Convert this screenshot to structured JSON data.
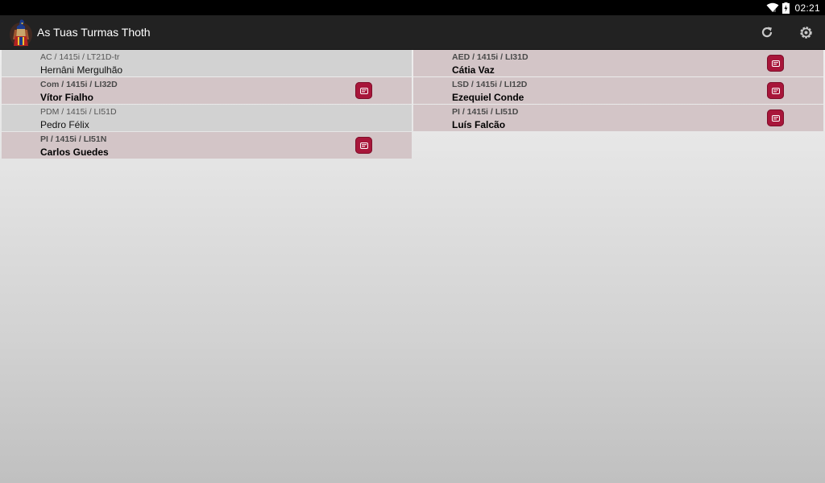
{
  "status_bar": {
    "time": "02:21",
    "icons": [
      "wifi-icon",
      "battery-charging-icon"
    ]
  },
  "action_bar": {
    "title": "As Tuas Turmas Thoth",
    "logo": "thoth-logo-icon",
    "actions": [
      {
        "name": "refresh",
        "icon": "refresh-icon"
      },
      {
        "name": "settings",
        "icon": "settings-icon"
      }
    ]
  },
  "classes": [
    {
      "code": "AC / 1415i / LT21D-tr",
      "teacher": "Hernâni Mergulhão",
      "has_news": false
    },
    {
      "code": "AED / 1415i / LI31D",
      "teacher": "Cátia Vaz",
      "has_news": true
    },
    {
      "code": "Com / 1415i / LI32D",
      "teacher": "Vítor Fialho",
      "has_news": true
    },
    {
      "code": "LSD / 1415i / LI12D",
      "teacher": "Ezequiel Conde",
      "has_news": true
    },
    {
      "code": "PDM / 1415i / LI51D",
      "teacher": "Pedro Félix",
      "has_news": false
    },
    {
      "code": "PI / 1415i / LI51D",
      "teacher": "Luís Falcão",
      "has_news": true
    },
    {
      "code": "PI / 1415i / LI51N",
      "teacher": "Carlos Guedes",
      "has_news": true
    }
  ],
  "colors": {
    "status_bar_bg": "#000000",
    "action_bar_bg": "#222222",
    "tile_read_bg": "#d2d2d2",
    "tile_unread_bg": "#d3c5c7",
    "badge_color": "#a8163a"
  }
}
